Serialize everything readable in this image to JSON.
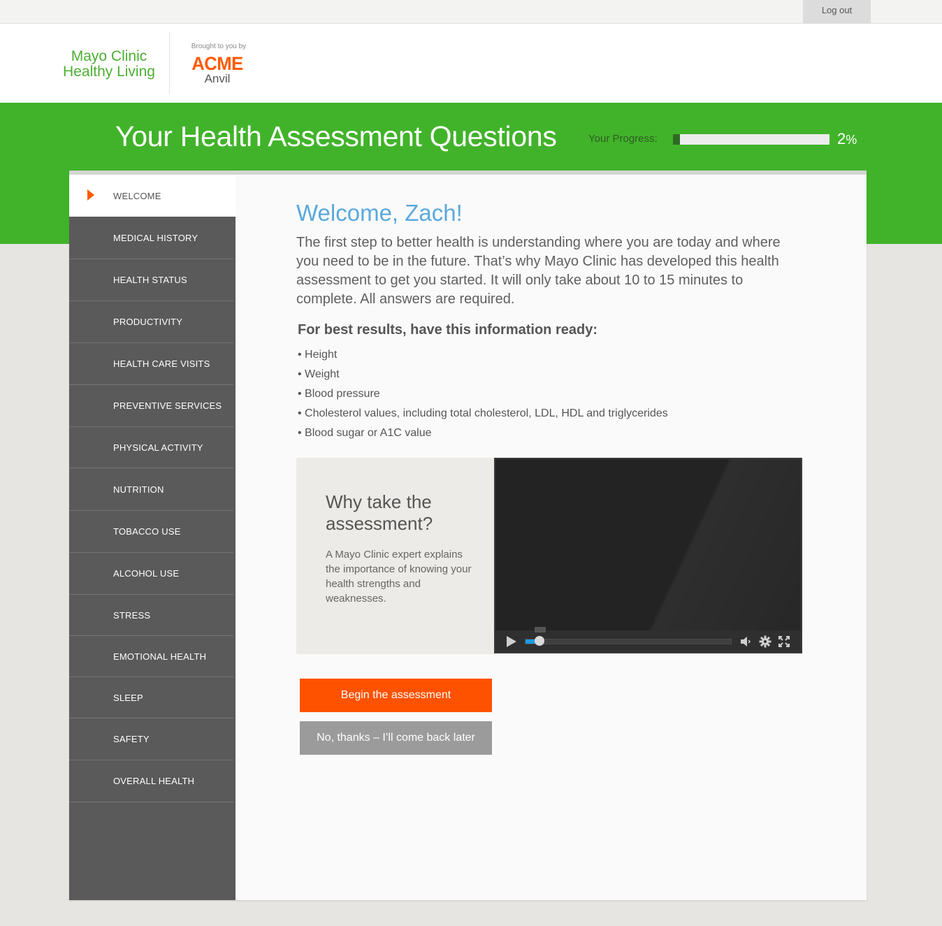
{
  "topbar": {
    "logout_label": "Log out"
  },
  "header": {
    "brand_line1": "Mayo Clinic",
    "brand_line2": "Healthy Living",
    "sponsor_label": "Brought to you by",
    "sponsor_name": "ACME",
    "sponsor_sub": "Anvil"
  },
  "banner": {
    "title": "Your Health Assessment Questions",
    "progress_label": "Your Progress:",
    "progress_percent": 2,
    "progress_value": "2",
    "progress_unit": "%"
  },
  "sidebar": {
    "items": [
      {
        "label": "WELCOME",
        "active": true
      },
      {
        "label": "MEDICAL HISTORY"
      },
      {
        "label": "HEALTH STATUS"
      },
      {
        "label": "PRODUCTIVITY"
      },
      {
        "label": "HEALTH CARE VISITS"
      },
      {
        "label": "PREVENTIVE SERVICES"
      },
      {
        "label": "PHYSICAL ACTIVITY"
      },
      {
        "label": "NUTRITION"
      },
      {
        "label": "TOBACCO USE"
      },
      {
        "label": "ALCOHOL USE"
      },
      {
        "label": "STRESS"
      },
      {
        "label": "EMOTIONAL HEALTH"
      },
      {
        "label": "SLEEP"
      },
      {
        "label": "SAFETY"
      },
      {
        "label": "OVERALL HEALTH"
      }
    ]
  },
  "main": {
    "welcome": "Welcome, Zach!",
    "intro": "The first step to better health is understanding where you are today and where you need to be in the future. That’s why Mayo Clinic has developed this health assessment to get you started. It will only take about 10 to 15 minutes to complete. All answers are required.",
    "ready_heading": "For best results, have this information ready:",
    "ready_items": [
      "• Height",
      "• Weight",
      "• Blood pressure",
      "• Cholesterol values, including total cholesterol, LDL, HDL and triglycerides",
      "• Blood sugar or A1C value"
    ],
    "video": {
      "title_line1": "Why take the",
      "title_line2": "assessment?",
      "description": "A Mayo Clinic expert explains the importance of knowing your health strengths and weaknesses.",
      "playback_progress": 0.07
    },
    "begin_label": "Begin the assessment",
    "later_label": "No, thanks – I’ll come back later"
  },
  "colors": {
    "brand_green": "#41b32a",
    "accent_orange": "#ff5200",
    "welcome_blue": "#5aa9dc",
    "sidebar_gray": "#5a5a5a"
  }
}
